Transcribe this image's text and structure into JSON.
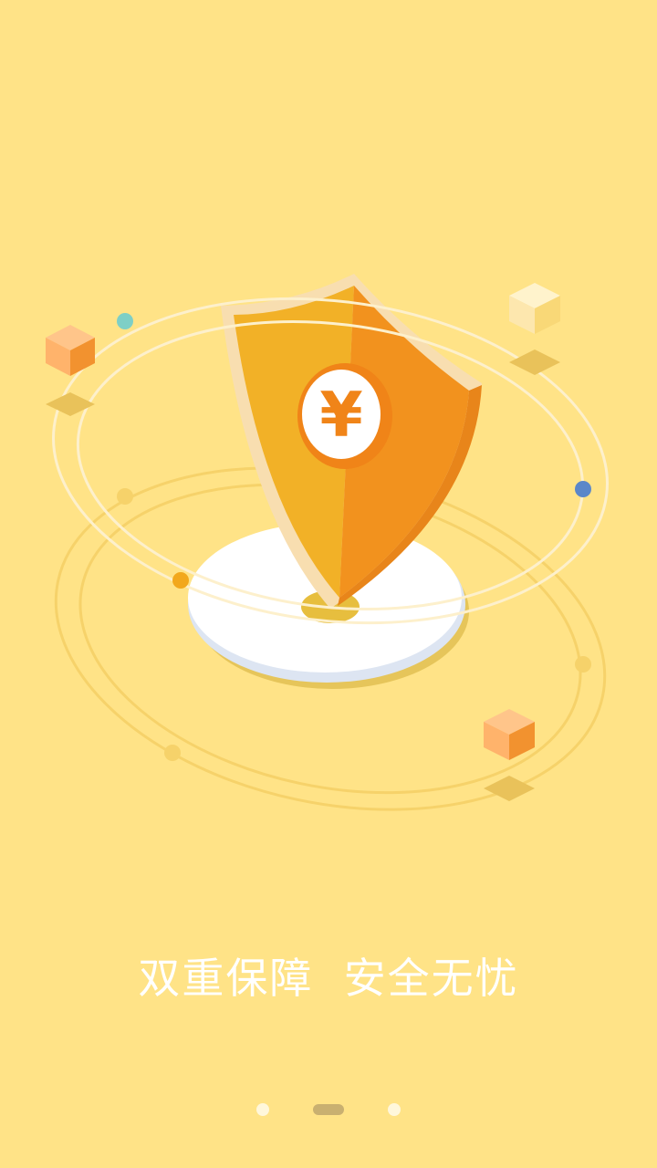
{
  "onboarding": {
    "slogan": "双重保障  安全无忧",
    "currency_symbol": "¥",
    "pages": 3,
    "active_page": 2
  },
  "colors": {
    "background": "#FFE387",
    "shield_left": "#F2B127",
    "shield_right": "#F2921E",
    "coin": "#F08418",
    "indicator_active": "#C9B070"
  },
  "icons": {
    "hero": "shield-yen-icon"
  }
}
